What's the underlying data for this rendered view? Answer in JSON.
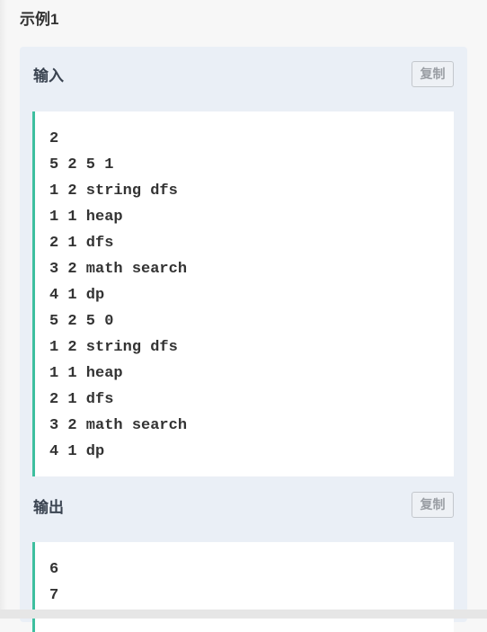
{
  "title": "示例1",
  "input": {
    "label": "输入",
    "copy_label": "复制",
    "lines": [
      "2",
      "5 2 5 1",
      "1 2 string dfs",
      "1 1 heap",
      "2 1 dfs",
      "3 2 math search",
      "4 1 dp",
      "5 2 5 0",
      "1 2 string dfs",
      "1 1 heap",
      "2 1 dfs",
      "3 2 math search",
      "4 1 dp"
    ]
  },
  "output": {
    "label": "输出",
    "copy_label": "复制",
    "lines": [
      "6",
      "7"
    ]
  }
}
